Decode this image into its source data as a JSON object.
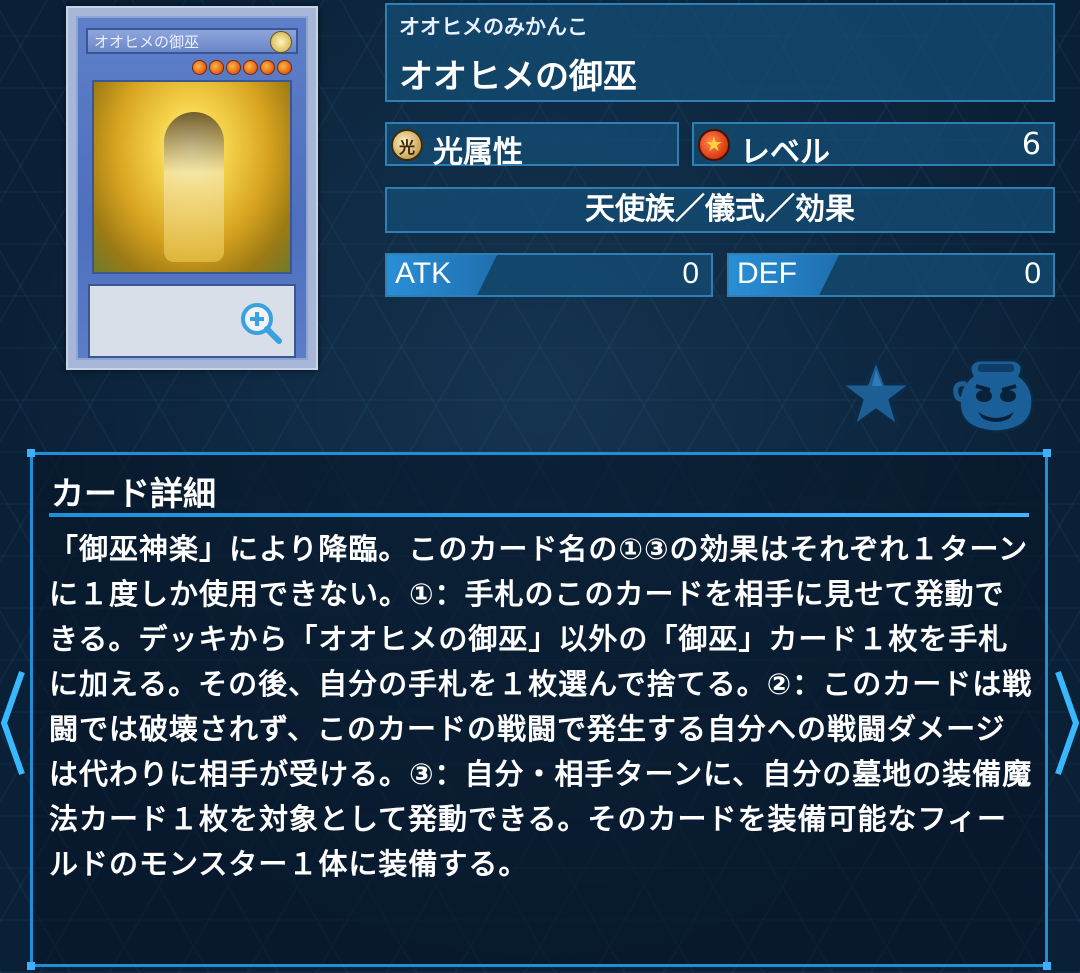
{
  "card": {
    "ruby": "オオヒメのみかんこ",
    "name": "オオヒメの御巫",
    "image_name_text": "オオヒメの御巫",
    "image_level_stars": 6,
    "attribute": {
      "icon": "light-attribute-icon",
      "icon_glyph": "光",
      "label": "光属性"
    },
    "level": {
      "icon": "level-star-icon",
      "label": "レベル",
      "value": "6"
    },
    "type_line": "天使族／儀式／効果",
    "atk": {
      "label": "ATK",
      "value": "0"
    },
    "def": {
      "label": "DEF",
      "value": "0"
    }
  },
  "actions": {
    "favorite_icon": "star-icon",
    "deck_icon": "jar-of-greed-icon",
    "zoom_icon": "zoom-in-icon"
  },
  "details": {
    "heading": "カード詳細",
    "text": "「御巫神楽」により降臨。このカード名の①③の効果はそれぞれ１ターンに１度しか使用できない。①：手札のこのカードを相手に見せて発動できる。デッキから「オオヒメの御巫」以外の「御巫」カード１枚を手札に加える。その後、自分の手札を１枚選んで捨てる。②：このカードは戦闘では破壊されず、このカードの戦闘で発生する自分への戦闘ダメージは代わりに相手が受ける。③：自分・相手ターンに、自分の墓地の装備魔法カード１枚を対象として発動できる。そのカードを装備可能なフィールドのモンスター１体に装備する。"
  },
  "navigation": {
    "prev_icon": "chevron-left-icon",
    "next_icon": "chevron-right-icon"
  },
  "colors": {
    "panel_border": "#2e7fb3",
    "accent": "#1f8fd6",
    "background": "#0a2036"
  }
}
